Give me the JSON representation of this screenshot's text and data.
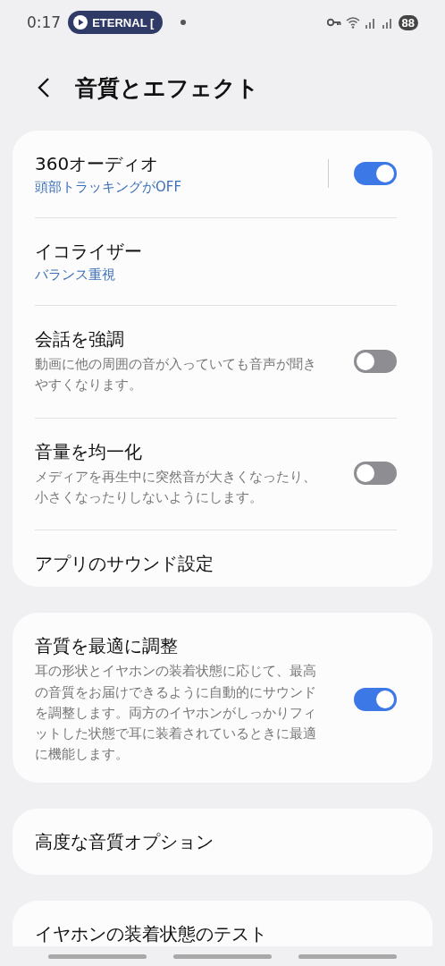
{
  "status_bar": {
    "time": "0:17",
    "media_chip": {
      "label": "ETERNAL ["
    },
    "battery": "88"
  },
  "header": {
    "title": "音質とエフェクト"
  },
  "groups": [
    {
      "items": [
        {
          "kind": "split_switch",
          "title": "360オーディオ",
          "summary": "頭部トラッキングがOFF",
          "on": true
        },
        {
          "kind": "link",
          "title": "イコライザー",
          "summary": "バランス重視"
        },
        {
          "kind": "switch",
          "title": "会話を強調",
          "description": "動画に他の周囲の音が入っていても音声が聞きやすくなります。",
          "on": false
        },
        {
          "kind": "switch",
          "title": "音量を均一化",
          "description": "メディアを再生中に突然音が大きくなったり、小さくなったりしないようにします。",
          "on": false
        },
        {
          "kind": "link",
          "title": "アプリのサウンド設定"
        }
      ]
    },
    {
      "items": [
        {
          "kind": "switch",
          "title": "音質を最適に調整",
          "description": "耳の形状とイヤホンの装着状態に応じて、最高の音質をお届けできるように自動的にサウンドを調整します。両方のイヤホンがしっかりフィットした状態で耳に装着されているときに最適に機能します。",
          "on": true
        }
      ]
    },
    {
      "items": [
        {
          "kind": "link",
          "title": "高度な音質オプション"
        }
      ]
    },
    {
      "items": [
        {
          "kind": "link",
          "title": "イヤホンの装着状態のテスト"
        }
      ]
    }
  ]
}
